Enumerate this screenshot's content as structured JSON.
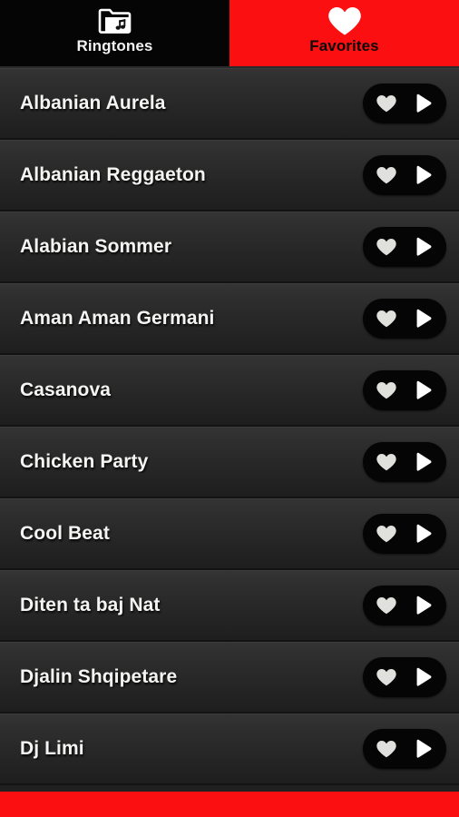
{
  "tabs": [
    {
      "label": "Ringtones",
      "icon": "music-folder-icon",
      "active": false
    },
    {
      "label": "Favorites",
      "icon": "heart-icon",
      "active": true
    }
  ],
  "colors": {
    "accent_red": "#fb0f11",
    "tab_inactive_bg": "#050505",
    "row_bg_top": "#343434",
    "row_bg_bottom": "#1e1e1e",
    "row_title": "#f4f4f2",
    "pill_bg": "#050505",
    "heart_icon": "#e0e0dc",
    "play_icon": "#ffffff"
  },
  "list": {
    "items": [
      {
        "title": "Albanian Aurela",
        "favorite_icon": "heart-icon",
        "play_icon": "play-icon"
      },
      {
        "title": "Albanian Reggaeton",
        "favorite_icon": "heart-icon",
        "play_icon": "play-icon"
      },
      {
        "title": "Alabian Sommer",
        "favorite_icon": "heart-icon",
        "play_icon": "play-icon"
      },
      {
        "title": "Aman Aman Germani",
        "favorite_icon": "heart-icon",
        "play_icon": "play-icon"
      },
      {
        "title": "Casanova",
        "favorite_icon": "heart-icon",
        "play_icon": "play-icon"
      },
      {
        "title": "Chicken Party",
        "favorite_icon": "heart-icon",
        "play_icon": "play-icon"
      },
      {
        "title": "Cool Beat",
        "favorite_icon": "heart-icon",
        "play_icon": "play-icon"
      },
      {
        "title": "Diten ta baj Nat",
        "favorite_icon": "heart-icon",
        "play_icon": "play-icon"
      },
      {
        "title": "Djalin Shqipetare",
        "favorite_icon": "heart-icon",
        "play_icon": "play-icon"
      },
      {
        "title": "Dj Limi",
        "favorite_icon": "heart-icon",
        "play_icon": "play-icon"
      }
    ]
  },
  "bottom_bar": {
    "label": ""
  }
}
